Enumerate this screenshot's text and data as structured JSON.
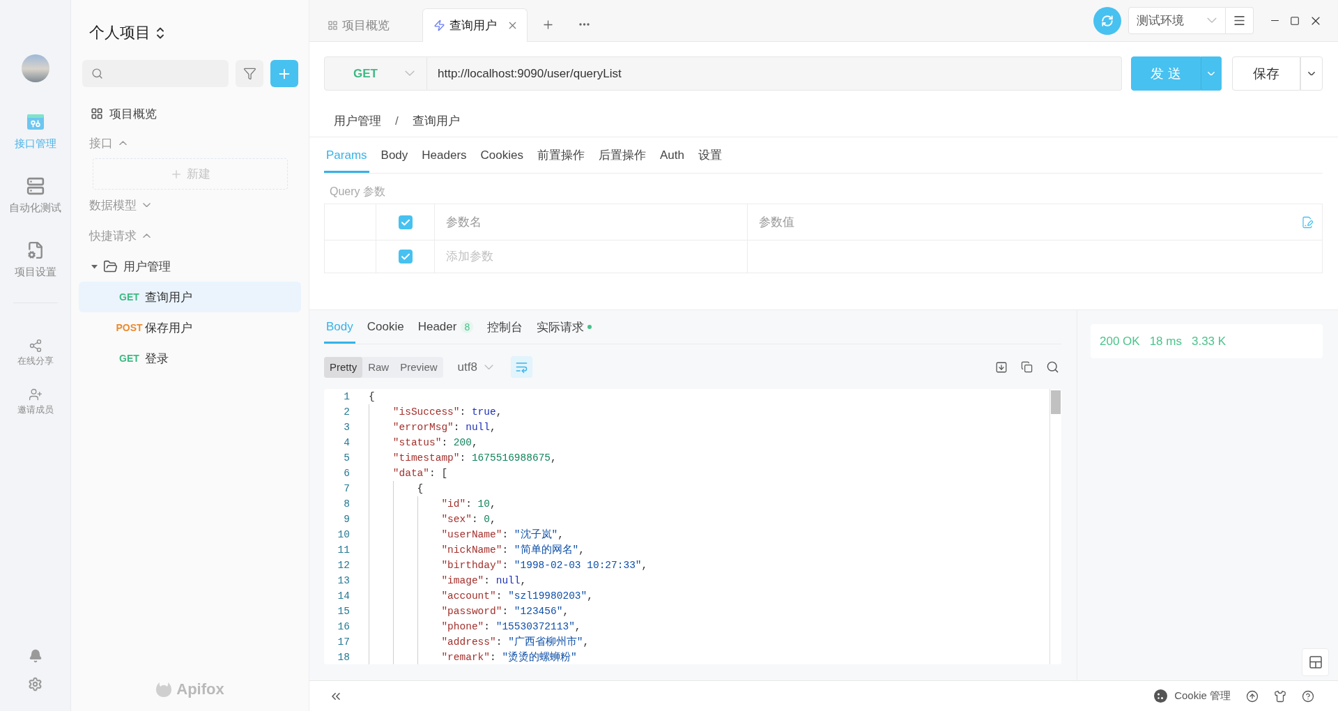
{
  "rail": {
    "items": [
      {
        "kind": "api",
        "label": "接口管理",
        "selected": true
      },
      {
        "kind": "automation",
        "label": "自动化测试",
        "selected": false
      },
      {
        "kind": "settings",
        "label": "项目设置",
        "selected": false
      }
    ],
    "actions": [
      {
        "kind": "share",
        "label": "在线分享"
      },
      {
        "kind": "invite",
        "label": "邀请成员"
      }
    ]
  },
  "sidebar": {
    "project": "个人项目",
    "overview": "项目概览",
    "sections": [
      {
        "label": "接口",
        "expanded": true,
        "new_button": "新建"
      },
      {
        "label": "数据模型",
        "expanded": false
      },
      {
        "label": "快捷请求",
        "expanded": true,
        "children": [
          {
            "name": "用户管理",
            "expanded": true,
            "children": [
              {
                "method": "GET",
                "color": "#3cba83",
                "name": "查询用户",
                "selected": true
              },
              {
                "method": "POST",
                "color": "#ea8a2e",
                "name": "保存用户",
                "selected": false
              },
              {
                "method": "GET",
                "color": "#3cba83",
                "name": "登录",
                "selected": false
              }
            ]
          }
        ]
      }
    ],
    "brand": "Apifox"
  },
  "tabs": [
    {
      "kind": "overview",
      "label": "项目概览",
      "selected": false
    },
    {
      "kind": "request",
      "label": "查询用户",
      "selected": true
    }
  ],
  "environment": "测试环境",
  "request": {
    "method": {
      "label": "GET",
      "color": "#3cba83"
    },
    "url": "http://localhost:9090/user/queryList",
    "send": "发 送",
    "save": "保存"
  },
  "breadcrumb": {
    "items": [
      "用户管理",
      "查询用户"
    ],
    "separator": "/"
  },
  "param_tabs": [
    {
      "label": "Params",
      "selected": true
    },
    {
      "label": "Body",
      "selected": false
    },
    {
      "label": "Headers",
      "selected": false
    },
    {
      "label": "Cookies",
      "selected": false
    },
    {
      "label": "前置操作",
      "selected": false
    },
    {
      "label": "后置操作",
      "selected": false
    },
    {
      "label": "Auth",
      "selected": false
    },
    {
      "label": "设置",
      "selected": false
    }
  ],
  "query": {
    "title": "Query 参数",
    "header": {
      "checked": true,
      "name": "参数名",
      "value": "参数值"
    },
    "rows": [
      {
        "checked": true,
        "placeholder": "添加参数"
      }
    ]
  },
  "response": {
    "tabs": [
      {
        "label": "Body",
        "selected": true
      },
      {
        "label": "Cookie",
        "selected": false
      },
      {
        "label": "Header",
        "selected": false,
        "badge": "8"
      },
      {
        "label": "控制台",
        "selected": false
      },
      {
        "label": "实际请求",
        "selected": false,
        "dot": true
      }
    ],
    "formats": [
      {
        "label": "Pretty",
        "selected": true
      },
      {
        "label": "Raw",
        "selected": false
      },
      {
        "label": "Preview",
        "selected": false
      }
    ],
    "encoding": "utf8",
    "wrap": true,
    "code": [
      {
        "number": "1",
        "tokens": [
          {
            "kind": "punct",
            "text": "{"
          }
        ],
        "children": [
          {
            "number": "2",
            "tokens": [
              {
                "kind": "key",
                "text": "\"isSuccess\""
              },
              {
                "kind": "punct",
                "text": ": "
              },
              {
                "kind": "literal",
                "text": "true"
              },
              {
                "kind": "punct",
                "text": ","
              }
            ]
          },
          {
            "number": "3",
            "tokens": [
              {
                "kind": "key",
                "text": "\"errorMsg\""
              },
              {
                "kind": "punct",
                "text": ": "
              },
              {
                "kind": "literal",
                "text": "null"
              },
              {
                "kind": "punct",
                "text": ","
              }
            ]
          },
          {
            "number": "4",
            "tokens": [
              {
                "kind": "key",
                "text": "\"status\""
              },
              {
                "kind": "punct",
                "text": ": "
              },
              {
                "kind": "number",
                "text": "200"
              },
              {
                "kind": "punct",
                "text": ","
              }
            ]
          },
          {
            "number": "5",
            "tokens": [
              {
                "kind": "key",
                "text": "\"timestamp\""
              },
              {
                "kind": "punct",
                "text": ": "
              },
              {
                "kind": "number",
                "text": "1675516988675"
              },
              {
                "kind": "punct",
                "text": ","
              }
            ]
          },
          {
            "number": "6",
            "tokens": [
              {
                "kind": "key",
                "text": "\"data\""
              },
              {
                "kind": "punct",
                "text": ": ["
              }
            ],
            "children": [
              {
                "number": "7",
                "tokens": [
                  {
                    "kind": "punct",
                    "text": "{"
                  }
                ],
                "children": [
                  {
                    "number": "8",
                    "tokens": [
                      {
                        "kind": "key",
                        "text": "\"id\""
                      },
                      {
                        "kind": "punct",
                        "text": ": "
                      },
                      {
                        "kind": "number",
                        "text": "10"
                      },
                      {
                        "kind": "punct",
                        "text": ","
                      }
                    ]
                  },
                  {
                    "number": "9",
                    "tokens": [
                      {
                        "kind": "key",
                        "text": "\"sex\""
                      },
                      {
                        "kind": "punct",
                        "text": ": "
                      },
                      {
                        "kind": "number",
                        "text": "0"
                      },
                      {
                        "kind": "punct",
                        "text": ","
                      }
                    ]
                  },
                  {
                    "number": "10",
                    "tokens": [
                      {
                        "kind": "key",
                        "text": "\"userName\""
                      },
                      {
                        "kind": "punct",
                        "text": ": "
                      },
                      {
                        "kind": "string",
                        "text": "\"沈子岚\""
                      },
                      {
                        "kind": "punct",
                        "text": ","
                      }
                    ]
                  },
                  {
                    "number": "11",
                    "tokens": [
                      {
                        "kind": "key",
                        "text": "\"nickName\""
                      },
                      {
                        "kind": "punct",
                        "text": ": "
                      },
                      {
                        "kind": "string",
                        "text": "\"简单的网名\""
                      },
                      {
                        "kind": "punct",
                        "text": ","
                      }
                    ]
                  },
                  {
                    "number": "12",
                    "tokens": [
                      {
                        "kind": "key",
                        "text": "\"birthday\""
                      },
                      {
                        "kind": "punct",
                        "text": ": "
                      },
                      {
                        "kind": "string",
                        "text": "\"1998-02-03 10:27:33\""
                      },
                      {
                        "kind": "punct",
                        "text": ","
                      }
                    ]
                  },
                  {
                    "number": "13",
                    "tokens": [
                      {
                        "kind": "key",
                        "text": "\"image\""
                      },
                      {
                        "kind": "punct",
                        "text": ": "
                      },
                      {
                        "kind": "literal",
                        "text": "null"
                      },
                      {
                        "kind": "punct",
                        "text": ","
                      }
                    ]
                  },
                  {
                    "number": "14",
                    "tokens": [
                      {
                        "kind": "key",
                        "text": "\"account\""
                      },
                      {
                        "kind": "punct",
                        "text": ": "
                      },
                      {
                        "kind": "string",
                        "text": "\"szl19980203\""
                      },
                      {
                        "kind": "punct",
                        "text": ","
                      }
                    ]
                  },
                  {
                    "number": "15",
                    "tokens": [
                      {
                        "kind": "key",
                        "text": "\"password\""
                      },
                      {
                        "kind": "punct",
                        "text": ": "
                      },
                      {
                        "kind": "string",
                        "text": "\"123456\""
                      },
                      {
                        "kind": "punct",
                        "text": ","
                      }
                    ]
                  },
                  {
                    "number": "16",
                    "tokens": [
                      {
                        "kind": "key",
                        "text": "\"phone\""
                      },
                      {
                        "kind": "punct",
                        "text": ": "
                      },
                      {
                        "kind": "string",
                        "text": "\"15530372113\""
                      },
                      {
                        "kind": "punct",
                        "text": ","
                      }
                    ]
                  },
                  {
                    "number": "17",
                    "tokens": [
                      {
                        "kind": "key",
                        "text": "\"address\""
                      },
                      {
                        "kind": "punct",
                        "text": ": "
                      },
                      {
                        "kind": "string",
                        "text": "\"广西省柳州市\""
                      },
                      {
                        "kind": "punct",
                        "text": ","
                      }
                    ]
                  },
                  {
                    "number": "18",
                    "tokens": [
                      {
                        "kind": "key",
                        "text": "\"remark\""
                      },
                      {
                        "kind": "punct",
                        "text": ": "
                      },
                      {
                        "kind": "string",
                        "text": "\"烫烫的螺蛳粉\""
                      }
                    ]
                  }
                ]
              }
            ]
          }
        ]
      }
    ],
    "summary": {
      "status": "200 OK",
      "time": "18 ms",
      "size": "3.33 K"
    }
  },
  "status_bar": {
    "cookie_manager": "Cookie 管理"
  }
}
